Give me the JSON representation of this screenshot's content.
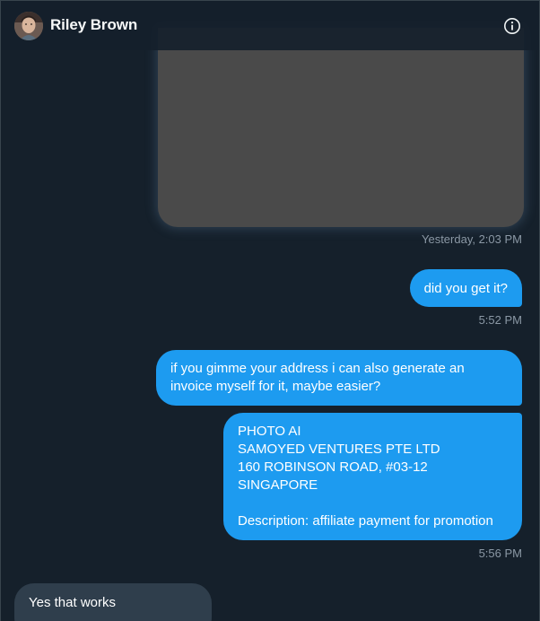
{
  "header": {
    "name": "Riley Brown",
    "info_icon": "info-icon",
    "avatar_icon": "avatar"
  },
  "messages": [
    {
      "type": "media",
      "direction": "sent",
      "timestamp": "Yesterday, 2:03 PM"
    },
    {
      "type": "text",
      "direction": "sent",
      "lines": [
        "did you get it?"
      ],
      "timestamp": "5:52 PM"
    },
    {
      "type": "text",
      "direction": "sent",
      "lines": [
        "if you gimme your address i can also generate an",
        "invoice myself for it, maybe easier?"
      ]
    },
    {
      "type": "text",
      "direction": "sent",
      "lines": [
        "PHOTO AI",
        "SAMOYED VENTURES PTE LTD",
        "160 ROBINSON ROAD, #03-12",
        "SINGAPORE",
        "",
        "Description: affiliate payment for promotion"
      ],
      "timestamp": "5:56 PM"
    },
    {
      "type": "text",
      "direction": "received",
      "lines": [
        "Yes that works"
      ]
    }
  ],
  "colors": {
    "background": "#15202b",
    "sent_bubble": "#1d9bf0",
    "received_bubble": "#2f3e4c",
    "timestamp": "#8b98a5",
    "media_placeholder": "#4a4a4a"
  }
}
